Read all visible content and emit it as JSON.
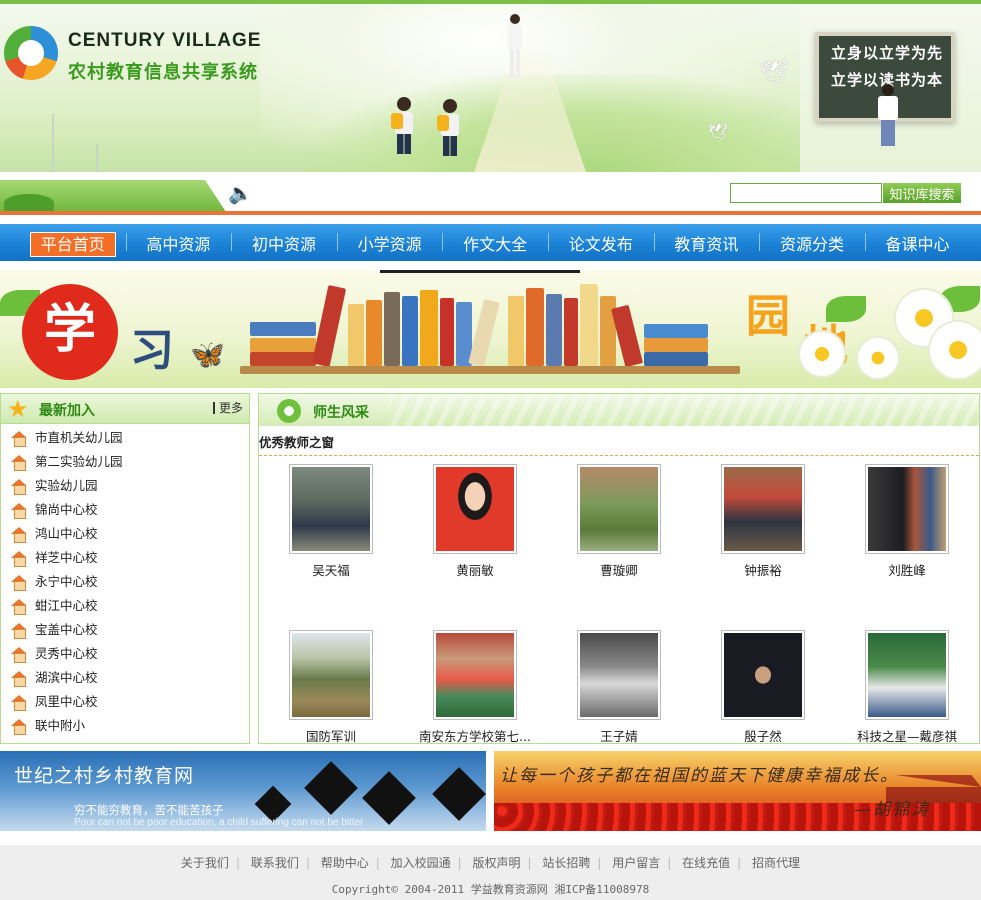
{
  "header": {
    "brand_en": "CENTURY VILLAGE",
    "brand_cn": "农村教育信息共享系统",
    "board_line1": "立身以立学为先",
    "board_line2": "立学以读书为本"
  },
  "search": {
    "placeholder": "",
    "button_label": "知识库搜索"
  },
  "nav": {
    "items": [
      "平台首页",
      "高中资源",
      "初中资源",
      "小学资源",
      "作文大全",
      "论文发布",
      "教育资讯",
      "资源分类",
      "备课中心"
    ],
    "active": "平台首页"
  },
  "learn_banner": {
    "char1": "学",
    "char2": "习",
    "char3": "园",
    "char4": "地"
  },
  "latest": {
    "title": "最新加入",
    "more": "更多",
    "items": [
      "市直机关幼儿园",
      "第二实验幼儿园",
      "实验幼儿园",
      "锦尚中心校",
      "鸿山中心校",
      "祥芝中心校",
      "永宁中心校",
      "蚶江中心校",
      "宝盖中心校",
      "灵秀中心校",
      "湖滨中心校",
      "凤里中心校",
      "联中附小"
    ]
  },
  "teachers": {
    "title": "师生风采",
    "subtitle": "优秀教师之窗",
    "cards": [
      {
        "name": "吴天福"
      },
      {
        "name": "黄丽敏"
      },
      {
        "name": "曹璇卿"
      },
      {
        "name": "钟振裕"
      },
      {
        "name": "刘胜峰"
      },
      {
        "name": "国防军训"
      },
      {
        "name": "南安东方学校第七..."
      },
      {
        "name": "王子婧"
      },
      {
        "name": "殷子然"
      },
      {
        "name": "科技之星—戴彦祺"
      }
    ]
  },
  "bottom_banners": {
    "left_title": "世纪之村乡村教育网",
    "left_cn": "穷不能穷教育，苦不能苦孩子",
    "left_en": "Poor can not be poor education, a child suffering can not be bitter",
    "right_slogan": "让每一个孩子都在祖国的蓝天下健康幸福成长。",
    "right_signature": "—胡锦涛"
  },
  "footer": {
    "links": [
      "关于我们",
      "联系我们",
      "帮助中心",
      "加入校园通",
      "版权声明",
      "站长招聘",
      "用户留言",
      "在线充值",
      "招商代理"
    ],
    "copyright": "Copyright© 2004-2011 学益教育资源网 湘ICP备11008978"
  },
  "colors": {
    "nav_blue": "#1c82d6",
    "nav_active": "#f36e26",
    "accent_green": "#2f8a14",
    "strip_orange": "#e8743a"
  }
}
